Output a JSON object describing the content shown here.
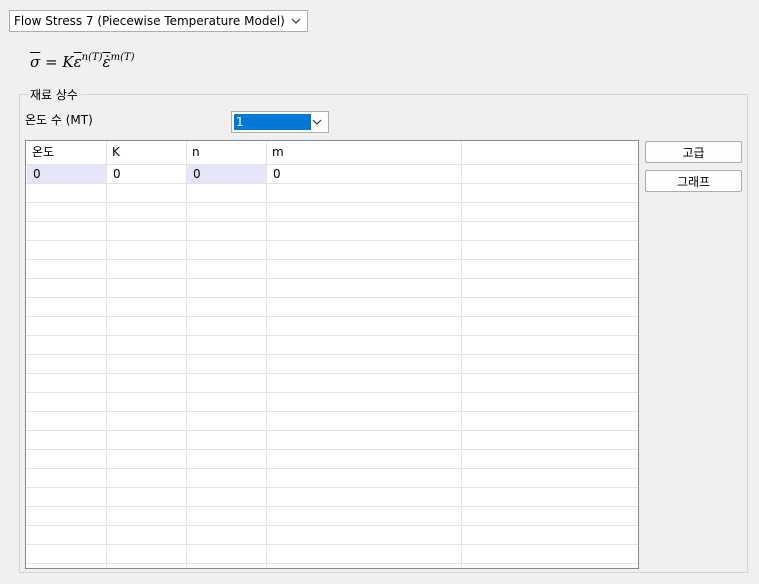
{
  "model": {
    "selected": "Flow Stress 7 (Piecewise Temperature Model)"
  },
  "formula": {
    "sigma": "σ",
    "eq": " = K",
    "eps": "ε",
    "exp_n": "n(T)",
    "epsdot": "ε̇",
    "exp_m": "m(T)"
  },
  "group": {
    "title": "재료 상수",
    "mt_label": "온도 수 (MT)",
    "mt_value": "1"
  },
  "table": {
    "headers": [
      "온도",
      "K",
      "n",
      "m",
      ""
    ],
    "rows": [
      [
        "0",
        "0",
        "0",
        "0",
        ""
      ]
    ]
  },
  "buttons": {
    "advanced": "고급",
    "graph": "그래프"
  },
  "colors": {
    "selection_blue": "#0078d7",
    "cell_highlight": "#e6e6fa"
  }
}
